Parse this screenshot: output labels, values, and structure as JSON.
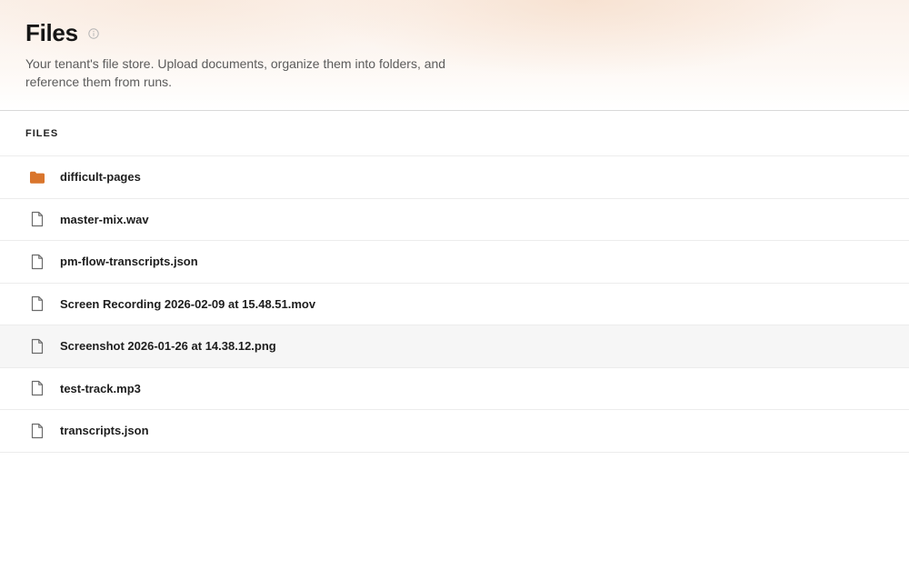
{
  "header": {
    "title": "Files",
    "subtitle": "Your tenant's file store. Upload documents, organize them into folders, and reference them from runs."
  },
  "files_section": {
    "label": "FILES",
    "items": [
      {
        "name": "difficult-pages",
        "icon": "folder-icon"
      },
      {
        "name": "master-mix.wav",
        "icon": "file-icon"
      },
      {
        "name": "pm-flow-transcripts.json",
        "icon": "file-icon"
      },
      {
        "name": "Screen Recording 2026-02-09 at 15.48.51.mov",
        "icon": "file-icon"
      },
      {
        "name": "Screenshot 2026-01-26 at 14.38.12.png",
        "icon": "file-icon"
      },
      {
        "name": "test-track.mp3",
        "icon": "file-icon"
      },
      {
        "name": "transcripts.json",
        "icon": "file-icon"
      }
    ]
  },
  "colors": {
    "folder": "#d9752c",
    "file_icon": "#6b6b6b",
    "highlight_row": "#f6f6f6"
  }
}
